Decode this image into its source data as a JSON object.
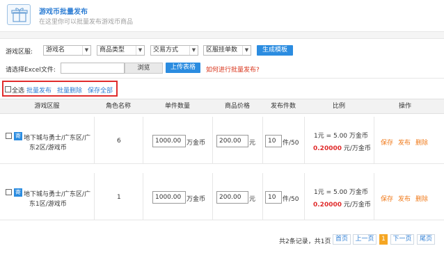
{
  "header": {
    "title": "游戏币批量发布",
    "subtitle": "在这里你可以批量发布游戏币商品",
    "icon": "gift-box-icon"
  },
  "filters": {
    "region_label": "游戏区服:",
    "game_select": "游戏名",
    "category_select": "商品类型",
    "trade_select": "交易方式",
    "order_select": "区服挂单数",
    "generate_btn": "生成模板",
    "excel_label": "请选择Excel文件:",
    "browse_btn": "浏览",
    "upload_btn": "上传表格",
    "help_link": "如何进行批量发布?"
  },
  "bulk": {
    "select_all": "全选",
    "bulk_publish": "批量发布",
    "bulk_delete": "批量删除",
    "save_all": "保存全部"
  },
  "table": {
    "headers": [
      "游戏区服",
      "角色名称",
      "单件数量",
      "商品价格",
      "发布件数",
      "比例",
      "操作"
    ],
    "rows": [
      {
        "tag": "寄",
        "server_line1": "地下城与勇士/广东区/广",
        "server_line2": "东2区/游戏币",
        "role_count": "6",
        "qty": "1000.00",
        "qty_unit": "万金币",
        "price": "200.00",
        "price_unit": "元",
        "pieces": "10",
        "pieces_suffix": "件/50",
        "ratio1": "1元 = 5.00 万金币",
        "ratio2_value": "0.20000",
        "ratio2_unit": "元/万金币",
        "save": "保存",
        "publish": "发布",
        "delete": "删除"
      },
      {
        "tag": "寄",
        "server_line1": "地下城与勇士/广东区/广",
        "server_line2": "东1区/游戏币",
        "role_count": "1",
        "qty": "1000.00",
        "qty_unit": "万金币",
        "price": "200.00",
        "price_unit": "元",
        "pieces": "10",
        "pieces_suffix": "件/50",
        "ratio1": "1元 = 5.00 万金币",
        "ratio2_value": "0.20000",
        "ratio2_unit": "元/万金币",
        "save": "保存",
        "publish": "发布",
        "delete": "删除"
      }
    ]
  },
  "pagination": {
    "summary": "共2条记录，共1页",
    "first": "首页",
    "prev": "上一页",
    "current": "1",
    "next": "下一页",
    "last": "尾页"
  },
  "colors": {
    "accent": "#2b8ce0",
    "highlight_box": "#e02b2b",
    "action": "#f07b1c"
  }
}
